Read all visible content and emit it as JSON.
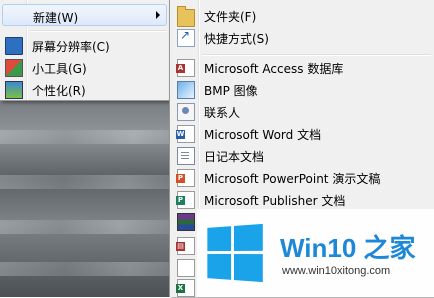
{
  "main_menu": {
    "items": [
      {
        "label": "新建(W)",
        "icon": "none",
        "has_submenu": true,
        "highlighted": true
      },
      {
        "label": "屏幕分辨率(C)",
        "icon": "monitor-icon"
      },
      {
        "label": "小工具(G)",
        "icon": "gadget-icon"
      },
      {
        "label": "个性化(R)",
        "icon": "personalize-icon"
      }
    ]
  },
  "new_submenu": {
    "items": [
      {
        "label": "文件夹(F)",
        "icon": "folder-icon"
      },
      {
        "label": "快捷方式(S)",
        "icon": "shortcut-icon"
      },
      {
        "label": "Microsoft Access 数据库",
        "icon": "access-icon"
      },
      {
        "label": "BMP 图像",
        "icon": "bmp-image-icon"
      },
      {
        "label": "联系人",
        "icon": "contact-icon"
      },
      {
        "label": "Microsoft Word 文档",
        "icon": "word-icon"
      },
      {
        "label": "日记本文档",
        "icon": "journal-icon"
      },
      {
        "label": "Microsoft PowerPoint 演示文稿",
        "icon": "powerpoint-icon"
      },
      {
        "label": "Microsoft Publisher 文档",
        "icon": "publisher-icon"
      }
    ]
  },
  "watermark": {
    "brand": "Win10 之家",
    "url": "www.win10xitong.com"
  },
  "colors": {
    "menu_bg": "#f0f0f0",
    "highlight_border": "#aecff7",
    "brand_blue": "#1e88d8"
  }
}
